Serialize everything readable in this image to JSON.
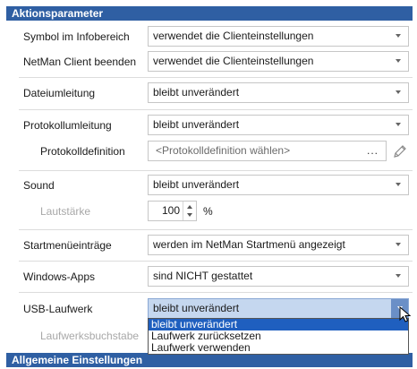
{
  "sections": {
    "action_params": "Aktionsparameter",
    "general_settings": "Allgemeine Einstellungen"
  },
  "rows": {
    "symbol": {
      "label": "Symbol im Infobereich",
      "value": "verwendet die Clienteinstellungen"
    },
    "client_exit": {
      "label": "NetMan Client beenden",
      "value": "verwendet die Clienteinstellungen"
    },
    "file_redirect": {
      "label": "Dateiumleitung",
      "value": "bleibt unverändert"
    },
    "log_redirect": {
      "label": "Protokollumleitung",
      "value": "bleibt unverändert"
    },
    "log_definition": {
      "label": "Protokolldefinition",
      "placeholder": "<Protokolldefinition wählen>",
      "browse": "..."
    },
    "sound": {
      "label": "Sound",
      "value": "bleibt unverändert"
    },
    "volume": {
      "label": "Lautstärke",
      "value": "100",
      "unit": "%"
    },
    "startmenu": {
      "label": "Startmenüeinträge",
      "value": "werden im NetMan Startmenü angezeigt"
    },
    "windows_apps": {
      "label": "Windows-Apps",
      "value": "sind NICHT gestattet"
    },
    "usb": {
      "label": "USB-Laufwerk",
      "value": "bleibt unverändert"
    },
    "drive_letter": {
      "label": "Laufwerksbuchstabe"
    }
  },
  "usb_options": [
    "bleibt unverändert",
    "Laufwerk zurücksetzen",
    "Laufwerk verwenden"
  ],
  "colors": {
    "header": "#2f5fa3",
    "selection": "#1f5fbf",
    "disabled": "#a8a8a8"
  }
}
